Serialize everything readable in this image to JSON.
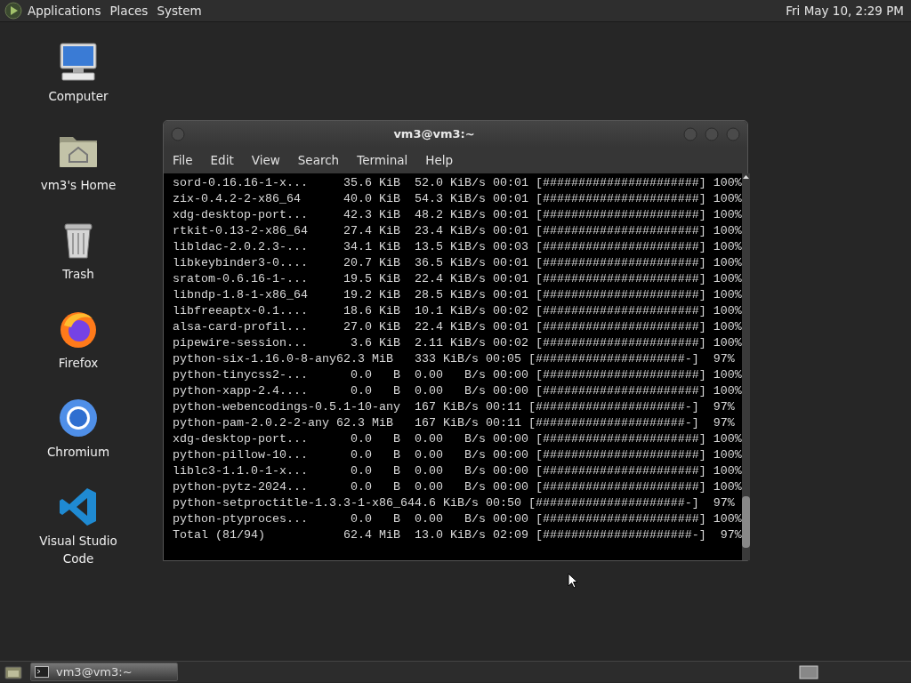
{
  "top_panel": {
    "menus": [
      "Applications",
      "Places",
      "System"
    ],
    "clock": "Fri May 10,  2:29 PM"
  },
  "desktop_icons": [
    {
      "kind": "computer",
      "label": "Computer"
    },
    {
      "kind": "home",
      "label": "vm3's Home"
    },
    {
      "kind": "trash",
      "label": "Trash"
    },
    {
      "kind": "firefox",
      "label": "Firefox"
    },
    {
      "kind": "chromium",
      "label": "Chromium"
    },
    {
      "kind": "vscode",
      "label": "Visual Studio Code"
    }
  ],
  "terminal": {
    "title": "vm3@vm3:~",
    "menu": [
      "File",
      "Edit",
      "View",
      "Search",
      "Terminal",
      "Help"
    ],
    "lines": [
      "sord-0.16.16-1-x...     35.6 KiB  52.0 KiB/s 00:01 [######################] 100%",
      "zix-0.4.2-2-x86_64      40.0 KiB  54.3 KiB/s 00:01 [######################] 100%",
      "xdg-desktop-port...     42.3 KiB  48.2 KiB/s 00:01 [######################] 100%",
      "rtkit-0.13-2-x86_64     27.4 KiB  23.4 KiB/s 00:01 [######################] 100%",
      "libldac-2.0.2.3-...     34.1 KiB  13.5 KiB/s 00:03 [######################] 100%",
      "libkeybinder3-0....     20.7 KiB  36.5 KiB/s 00:01 [######################] 100%",
      "sratom-0.6.16-1-...     19.5 KiB  22.4 KiB/s 00:01 [######################] 100%",
      "libndp-1.8-1-x86_64     19.2 KiB  28.5 KiB/s 00:01 [######################] 100%",
      "libfreeaptx-0.1....     18.6 KiB  10.1 KiB/s 00:02 [######################] 100%",
      "alsa-card-profil...     27.0 KiB  22.4 KiB/s 00:01 [######################] 100%",
      "pipewire-session...      3.6 KiB  2.11 KiB/s 00:02 [######################] 100%",
      "python-six-1.16.0-8-any62.3 MiB   333 KiB/s 00:05 [#####################-]  97%",
      "python-tinycss2-...      0.0   B  0.00   B/s 00:00 [######################] 100%",
      "python-xapp-2.4....      0.0   B  0.00   B/s 00:00 [######################] 100%",
      "python-webencodings-0.5.1-10-any  167 KiB/s 00:11 [#####################-]  97%",
      "python-pam-2.0.2-2-any 62.3 MiB   167 KiB/s 00:11 [#####################-]  97%",
      "xdg-desktop-port...      0.0   B  0.00   B/s 00:00 [######################] 100%",
      "python-pillow-10...      0.0   B  0.00   B/s 00:00 [######################] 100%",
      "liblc3-1.1.0-1-x...      0.0   B  0.00   B/s 00:00 [######################] 100%",
      "python-pytz-2024...      0.0   B  0.00   B/s 00:00 [######################] 100%",
      "python-setproctitle-1.3.3-1-x86_644.6 KiB/s 00:50 [#####################-]  97%",
      "python-ptyproces...      0.0   B  0.00   B/s 00:00 [######################] 100%",
      "Total (81/94)           62.4 MiB  13.0 KiB/s 02:09 [#####################-]  97%"
    ]
  },
  "taskbar": {
    "tasks": [
      {
        "label": "vm3@vm3:~",
        "selected": true
      }
    ]
  }
}
